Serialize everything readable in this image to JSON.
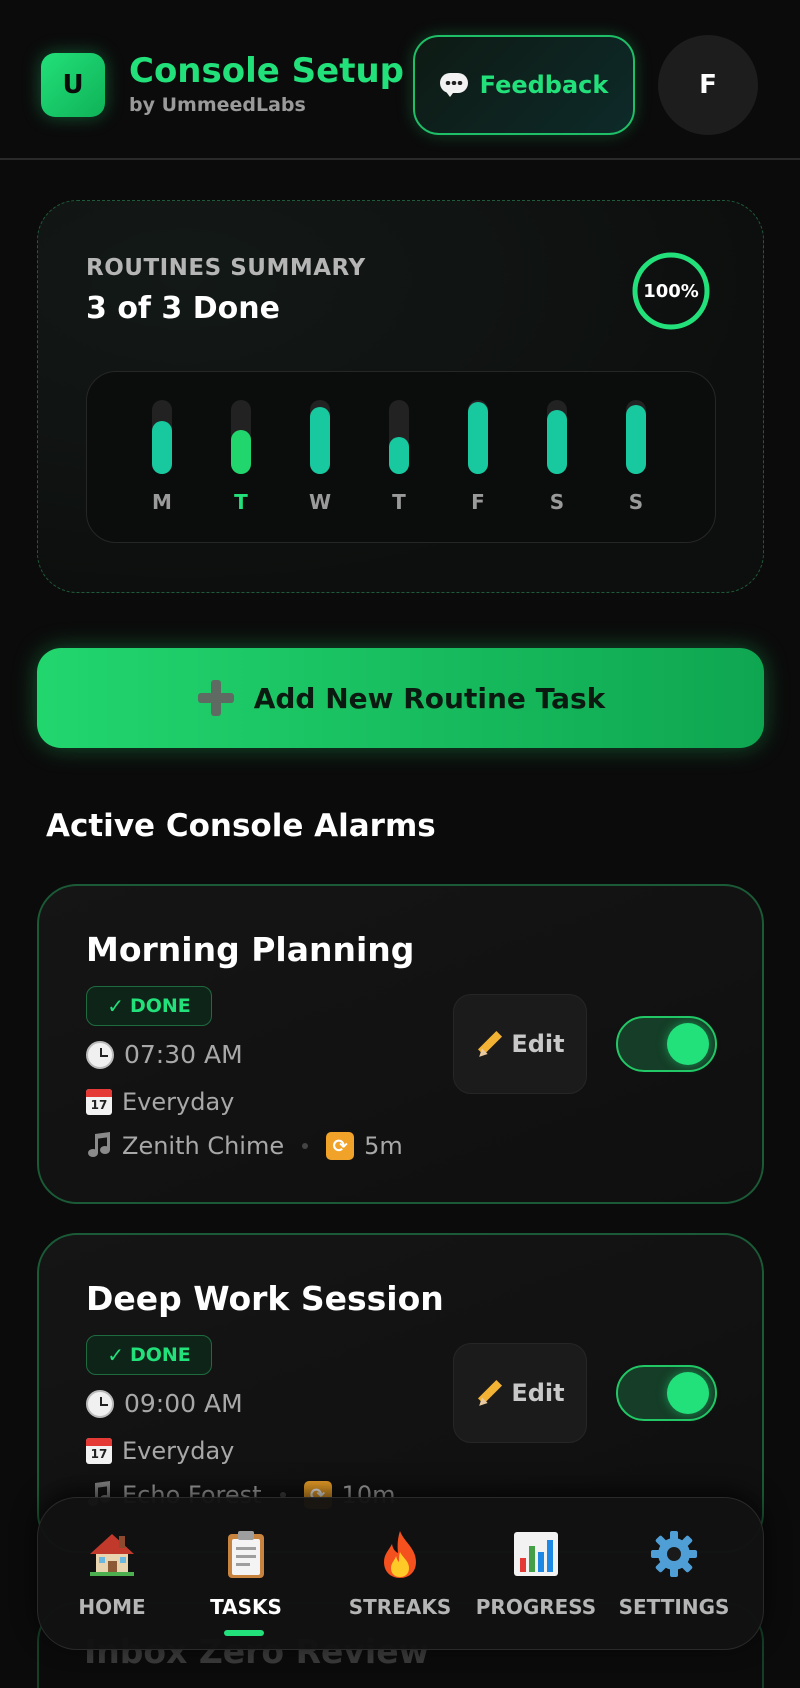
{
  "header": {
    "logo_letter": "U",
    "title": "Console Setup",
    "subtitle": "by UmmeedLabs",
    "feedback_label": "Feedback",
    "avatar_letter": "F"
  },
  "summary": {
    "label": "ROUTINES SUMMARY",
    "value": "3 of 3 Done",
    "percent_label": "100%",
    "percent": 100,
    "week": [
      {
        "day": "M",
        "fill": 0.72,
        "today": false
      },
      {
        "day": "T",
        "fill": 0.6,
        "today": true
      },
      {
        "day": "W",
        "fill": 0.9,
        "today": false
      },
      {
        "day": "T",
        "fill": 0.5,
        "today": false
      },
      {
        "day": "F",
        "fill": 0.97,
        "today": false
      },
      {
        "day": "S",
        "fill": 0.86,
        "today": false
      },
      {
        "day": "S",
        "fill": 0.93,
        "today": false
      }
    ]
  },
  "add_button_label": "Add New Routine Task",
  "section_title": "Active Console Alarms",
  "alarms": [
    {
      "title": "Morning Planning",
      "status": "DONE",
      "time": "07:30 AM",
      "repeat": "Everyday",
      "sound": "Zenith Chime",
      "snooze": "5m",
      "edit_label": "Edit",
      "enabled": true
    },
    {
      "title": "Deep Work Session",
      "status": "DONE",
      "time": "09:00 AM",
      "repeat": "Everyday",
      "sound": "Echo Forest",
      "snooze": "10m",
      "edit_label": "Edit",
      "enabled": true
    },
    {
      "title": "Inbox Zero Review"
    }
  ],
  "nav": {
    "items": [
      {
        "label": "HOME",
        "icon": "house-icon"
      },
      {
        "label": "TASKS",
        "icon": "clipboard-icon"
      },
      {
        "label": "STREAKS",
        "icon": "fire-icon"
      },
      {
        "label": "PROGRESS",
        "icon": "bar-chart-icon"
      },
      {
        "label": "SETTINGS",
        "icon": "gear-icon"
      }
    ],
    "active": "TASKS"
  },
  "colors": {
    "accent": "#22e07a",
    "teal": "#18c9a0",
    "background": "#0b0b0b"
  }
}
